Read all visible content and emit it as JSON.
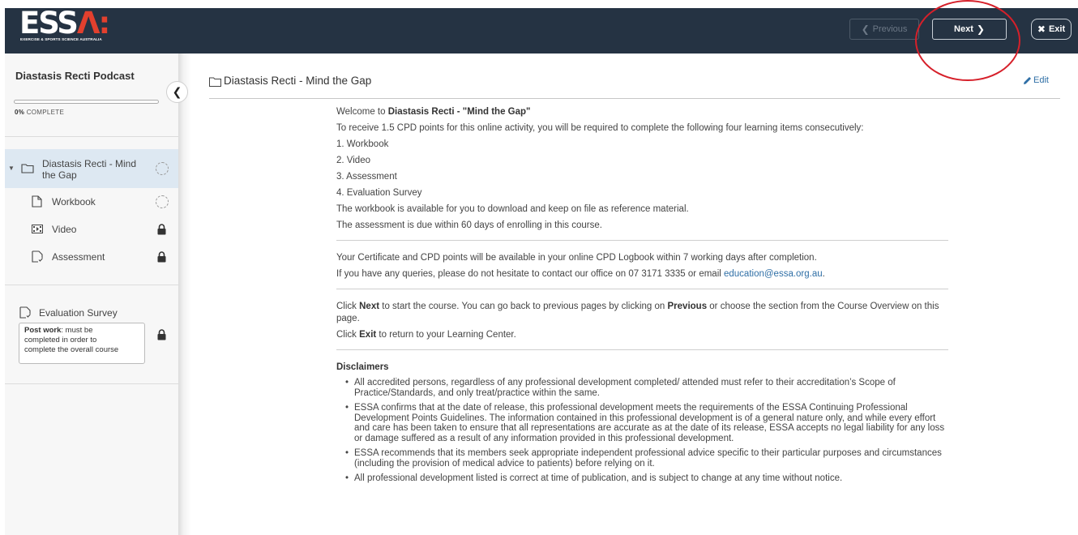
{
  "header": {
    "logo_text": "ESS",
    "logo_accent": "Λ:",
    "logo_tagline": "EXERCISE & SPORTS SCIENCE AUSTRALIA",
    "prev_label": "Previous",
    "next_label": "Next",
    "exit_label": "Exit",
    "colors": {
      "bar": "#253343",
      "accent": "#e2402e",
      "annotation": "#d6202a"
    }
  },
  "sidebar": {
    "title": "Diastasis Recti Podcast",
    "progress_percent": "0%",
    "progress_suffix": "COMPLETE",
    "items": [
      {
        "label_line1": "Diastasis Recti - Mind",
        "label_line2": "the Gap",
        "icon": "folder-icon",
        "status": "incomplete"
      },
      {
        "label": "Workbook",
        "icon": "document-icon",
        "status": "incomplete"
      },
      {
        "label": "Video",
        "icon": "video-icon",
        "status": "locked"
      },
      {
        "label": "Assessment",
        "icon": "assessment-icon",
        "status": "locked"
      }
    ],
    "post": {
      "label": "Evaluation Survey",
      "note_bold": "Post work",
      "note_rest_1": ": must be",
      "note_line2": "completed in order to",
      "note_line3": "complete the overall course",
      "status": "locked"
    }
  },
  "main": {
    "title": "Diastasis Recti - Mind the Gap",
    "edit_label": "Edit",
    "welcome_prefix": "Welcome to ",
    "welcome_bold": "Diastasis Recti - \"Mind the Gap\"",
    "intro": "To receive 1.5 CPD points for this online activity, you will be required to complete the following four learning items consecutively:",
    "steps": [
      "1. Workbook",
      "2. Video",
      "3. Assessment",
      "4. Evaluation Survey"
    ],
    "workbook_note": "The workbook is available for you to download and keep on file as reference material.",
    "due_note": "The assessment is due within 60 days of enrolling in this course.",
    "certificate_note": "Your Certificate and CPD points will be available in your online CPD Logbook within 7 working days after completion.",
    "contact_prefix": "If you have any queries, please do not hesitate to contact our office on 07 3171 3335 or email ",
    "contact_email": "education@essa.org.au",
    "contact_suffix": ".",
    "click_next_1": "Click ",
    "click_next_bold": "Next",
    "click_next_2": " to start the course. You can go back to previous pages by clicking on ",
    "click_prev_bold": "Previous",
    "click_next_3": " or choose the section from the Course Overview on this page.",
    "click_exit_1": "Click ",
    "click_exit_bold": "Exit",
    "click_exit_2": " to return to your Learning Center.",
    "disclaimers_title": "Disclaimers",
    "disclaimers": [
      "All accredited persons, regardless of any professional development completed/ attended must refer to their accreditation’s Scope of Practice/Standards, and only treat/practice within the same.",
      "ESSA confirms that at the date of release, this professional development meets the requirements of the ESSA Continuing Professional Development Points Guidelines. The information contained in this professional development is of a general nature only, and while every effort and care has been taken to ensure that all representations are accurate as at the date of its release, ESSA accepts no legal liability for any loss or damage suffered as a result of any information provided in this professional development.",
      "ESSA recommends that its members seek appropriate independent professional advice specific to their particular purposes and circumstances (including the provision of medical advice to patients) before relying on it.",
      "All professional development listed is correct at time of publication, and is subject to change at any time without notice."
    ]
  }
}
